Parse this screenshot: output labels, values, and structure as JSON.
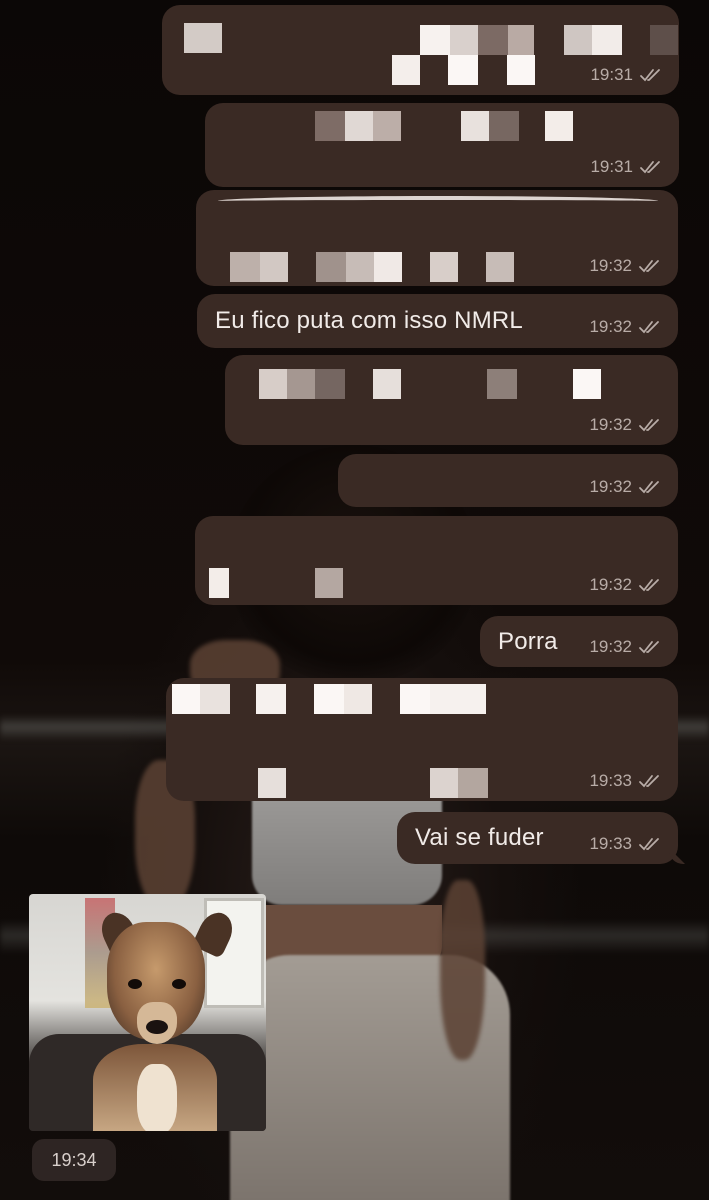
{
  "chat": {
    "messages": [
      {
        "direction": "outgoing",
        "text": "",
        "redacted": true,
        "time": "19:31",
        "status": "read"
      },
      {
        "direction": "outgoing",
        "text": "",
        "redacted": true,
        "time": "19:31",
        "status": "read"
      },
      {
        "direction": "outgoing",
        "text": "",
        "redacted": true,
        "time": "19:32",
        "status": "read"
      },
      {
        "direction": "outgoing",
        "text": "Eu fico puta com isso NMRL",
        "redacted": false,
        "time": "19:32",
        "status": "read"
      },
      {
        "direction": "outgoing",
        "text": "",
        "redacted": true,
        "time": "19:32",
        "status": "read"
      },
      {
        "direction": "outgoing",
        "text": "",
        "redacted": true,
        "time": "19:32",
        "status": "read"
      },
      {
        "direction": "outgoing",
        "text": "",
        "redacted": true,
        "time": "19:32",
        "status": "read"
      },
      {
        "direction": "outgoing",
        "text": "Porra",
        "redacted": false,
        "time": "19:32",
        "status": "read"
      },
      {
        "direction": "outgoing",
        "text": "",
        "redacted": true,
        "time": "19:33",
        "status": "read"
      },
      {
        "direction": "outgoing",
        "text": "Vai se fuder",
        "redacted": false,
        "time": "19:33",
        "status": "read"
      },
      {
        "direction": "incoming",
        "type": "image",
        "image_icon": "dog-photo",
        "time": "19:34"
      }
    ]
  },
  "icons": {
    "read_receipt": "double-check-icon"
  },
  "colors": {
    "bubble": "#3a2a24",
    "meta_text": "#b8aca7",
    "message_text": "#f1ebe8",
    "background": "#0c0807"
  }
}
